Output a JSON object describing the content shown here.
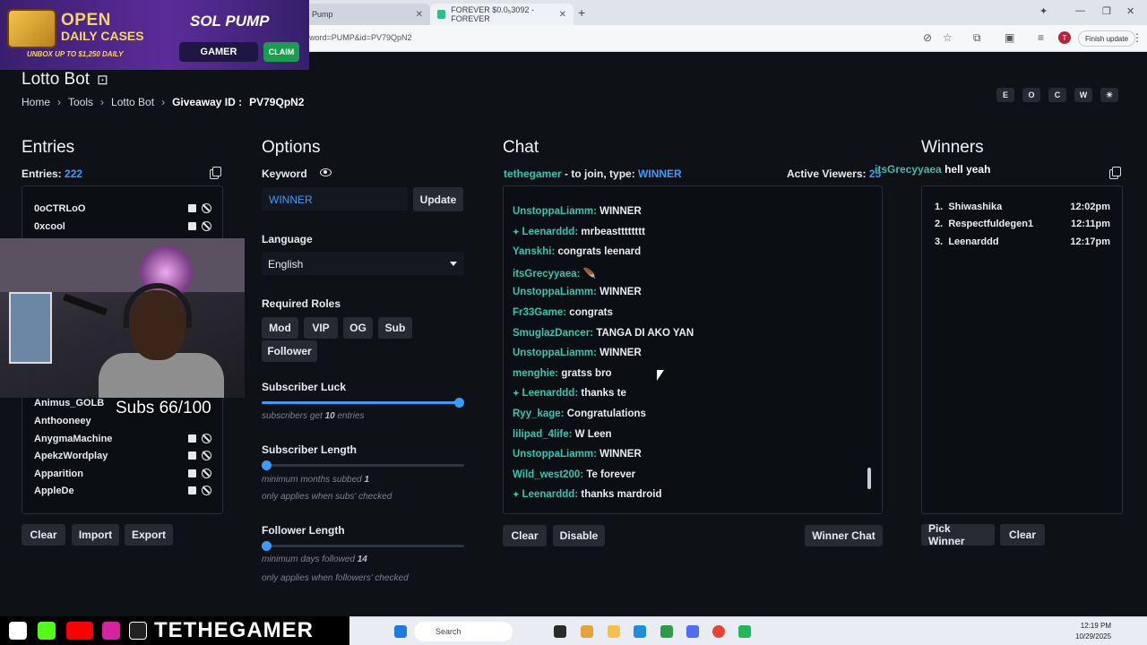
{
  "browser": {
    "tabs": [
      {
        "label": "Pump"
      },
      {
        "label": "FOREVER $0.0₅3092 - FOREVER"
      }
    ],
    "url": "word=PUMP&id=PV79QpN2",
    "finish_update": "Finish update",
    "avatar_letter": "T"
  },
  "ad": {
    "line1": "OPEN",
    "line2": "DAILY CASES",
    "tagline": "UNBOX UP TO $1,250 DAILY",
    "brand": "SOL PUMP",
    "gamer": "GAMER",
    "claim": "CLAIM"
  },
  "app": {
    "title": "Lotto Bot",
    "breadcrumb": {
      "home": "Home",
      "tools": "Tools",
      "lotto": "Lotto Bot",
      "giveaway_label": "Giveaway ID :",
      "giveaway_id": "PV79QpN2"
    },
    "theme_buttons": [
      "E",
      "O",
      "C",
      "W",
      "☀"
    ]
  },
  "entries": {
    "heading": "Entries",
    "count_label": "Entries:",
    "count": "222",
    "items_top": [
      "0oCTRLoO",
      "0xcool"
    ],
    "items_bottom": [
      "Animus_GOLB",
      "Anthooneey",
      "AnygmaMachine",
      "ApekzWordplay",
      "Apparition",
      "AppleDe"
    ],
    "buttons": {
      "clear": "Clear",
      "import": "Import",
      "export": "Export"
    }
  },
  "overlay": {
    "subs": "Subs 66/100"
  },
  "options": {
    "heading": "Options",
    "keyword_label": "Keyword",
    "keyword_value": "WINNER",
    "update": "Update",
    "language_label": "Language",
    "language_value": "English",
    "roles_label": "Required Roles",
    "roles": [
      "Mod",
      "VIP",
      "OG",
      "Sub",
      "Follower"
    ],
    "sub_luck_label": "Subscriber Luck",
    "sub_luck_hint_pre": "subscribers get",
    "sub_luck_value": "10",
    "sub_luck_hint_post": "entries",
    "sub_luck_level": 1.0,
    "sub_length_label": "Subscriber Length",
    "sub_length_hint_pre": "minimum months subbed",
    "sub_length_value": "1",
    "sub_length_hint2": "only applies when subs' checked",
    "sub_length_level": 0.0,
    "follower_length_label": "Follower Length",
    "follower_length_hint_pre": "minimum days followed",
    "follower_length_value": "14",
    "follower_length_hint2": "only applies when followers' checked",
    "follower_length_level": 0.0
  },
  "chat": {
    "heading": "Chat",
    "host": "tethegamer",
    "join_text": "- to join, type:",
    "join_word": "WINNER",
    "viewers_label": "Active Viewers:",
    "viewers_value": "25",
    "messages": [
      {
        "user": "UnstoppaLiamm:",
        "text": "WINNER",
        "star": false
      },
      {
        "user": "Leenarddd:",
        "text": "mrbeastttttttt",
        "star": true
      },
      {
        "user": "Yanskhi:",
        "text": "congrats leenard",
        "star": false
      },
      {
        "user": "itsGrecyyaea:",
        "text": "🪶",
        "star": false
      },
      {
        "user": "UnstoppaLiamm:",
        "text": "WINNER",
        "star": false
      },
      {
        "user": "Fr33Game:",
        "text": "congrats",
        "star": false
      },
      {
        "user": "SmuglazDancer:",
        "text": "TANGA DI AKO YAN",
        "star": false
      },
      {
        "user": "UnstoppaLiamm:",
        "text": "WINNER",
        "star": false
      },
      {
        "user": "menghie:",
        "text": "gratss bro",
        "star": false
      },
      {
        "user": "Leenarddd:",
        "text": "thanks te",
        "star": true
      },
      {
        "user": "Ryy_kage:",
        "text": "Congratulations",
        "star": false
      },
      {
        "user": "lilipad_4life:",
        "text": "W Leen",
        "star": false
      },
      {
        "user": "UnstoppaLiamm:",
        "text": "WINNER",
        "star": false
      },
      {
        "user": "Wild_west200:",
        "text": "Te forever",
        "star": false
      },
      {
        "user": "Leenarddd:",
        "text": "thanks mardroid",
        "star": true
      }
    ],
    "buttons": {
      "clear": "Clear",
      "disable": "Disable",
      "winner_chat": "Winner Chat"
    }
  },
  "stream_overlay": {
    "user": "itsGrecyyaea",
    "text": "hell yeah"
  },
  "winners": {
    "heading": "Winners",
    "list": [
      {
        "rank": "1.",
        "name": "Shiwashika",
        "time": "12:02pm"
      },
      {
        "rank": "2.",
        "name": "Respectfuldegen1",
        "time": "12:11pm"
      },
      {
        "rank": "3.",
        "name": "Leenarddd",
        "time": "12:17pm"
      }
    ],
    "buttons": {
      "pick": "Pick Winner",
      "clear": "Clear"
    }
  },
  "taskbar": {
    "search": "Search",
    "time": "12:19 PM",
    "date": "10/29/2025"
  },
  "branding": {
    "name": "TETHEGAMER"
  },
  "colors": {
    "accent": "#3b9cff",
    "username": "#2fc9b3",
    "panel_bg": "#0e1116"
  }
}
